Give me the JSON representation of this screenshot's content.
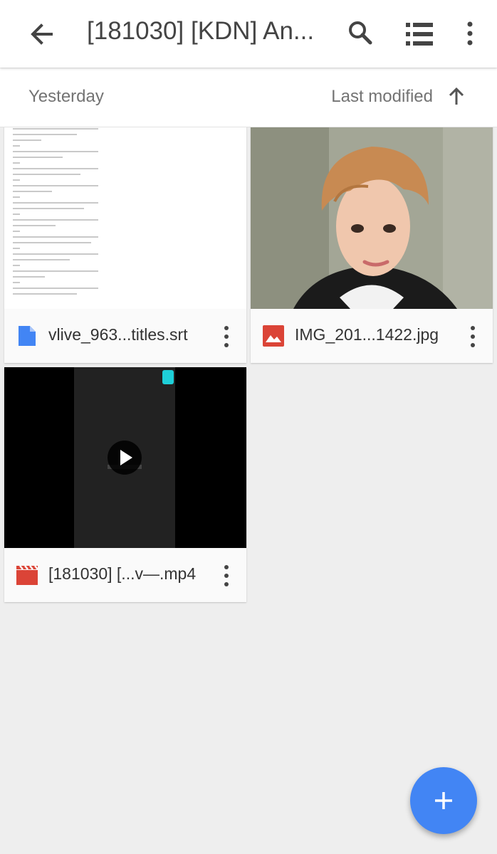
{
  "appbar": {
    "title": "[181030] [KDN] An...",
    "icons": [
      "back-arrow-icon",
      "search-icon",
      "list-view-icon",
      "more-vert-icon"
    ]
  },
  "sortbar": {
    "section_label": "Yesterday",
    "sort_label": "Last modified",
    "sort_direction": "ascending"
  },
  "files": [
    {
      "name": "vlive_963...titles.srt",
      "type_icon": "document-icon",
      "type_color": "#4285f4",
      "thumb": "subtitle-text-preview"
    },
    {
      "name": "IMG_201...1422.jpg",
      "type_icon": "image-icon",
      "type_color": "#db4437",
      "thumb": "portrait-photo"
    },
    {
      "name": "[181030] [...v—.mp4",
      "type_icon": "video-icon",
      "type_color": "#db4437",
      "thumb": "video-frame"
    }
  ],
  "fab": {
    "icon": "plus-icon",
    "color": "#4285f4"
  },
  "colors": {
    "accent": "#4285f4",
    "file_red": "#db4437",
    "background": "#eeeeee"
  }
}
